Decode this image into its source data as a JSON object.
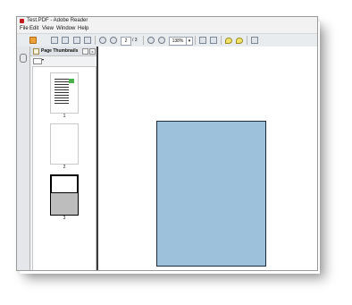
{
  "window": {
    "title": "Test.PDF - Adobe Reader"
  },
  "menu": [
    "File",
    "Edit",
    "View",
    "Window",
    "Help"
  ],
  "toolbar": {
    "page_current": "2",
    "page_total": "/ 3",
    "zoom": "138%",
    "zoom_dropdown": "▾"
  },
  "sidebar": {
    "pane_title": "Page Thumbnails",
    "pane_close": "x",
    "pane_options_arrow": "▾"
  },
  "thumbnails": [
    {
      "label": "1"
    },
    {
      "label": "2"
    },
    {
      "label": "3"
    }
  ],
  "colors": {
    "shape_fill": "#9dc0db",
    "shape_border": "#1d2a3a",
    "accent_app": "#c31b1b"
  }
}
